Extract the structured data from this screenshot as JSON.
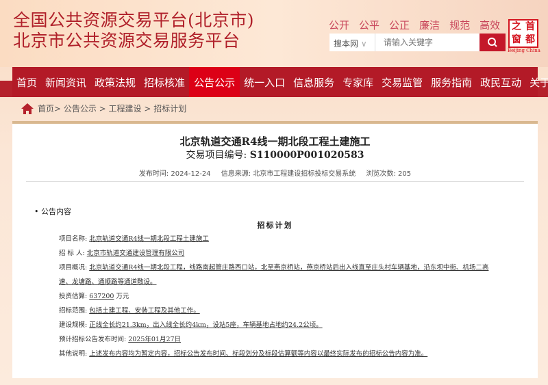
{
  "header": {
    "title1": "全国公共资源交易平台(北京市)",
    "title2": "北京市公共资源交易服务平台",
    "slogans": [
      "公开",
      "公平",
      "公正",
      "廉洁",
      "规范",
      "高效"
    ],
    "search_scope": "搜本网",
    "search_placeholder": "请输入关键字",
    "logo_chars": [
      "之",
      "首",
      "窗",
      "都"
    ],
    "logo_sub": "Beijing China"
  },
  "nav": [
    "首页",
    "新闻资讯",
    "政策法规",
    "招标核准",
    "公告公示",
    "统一入口",
    "信息服务",
    "专家库",
    "交易监管",
    "服务指南",
    "政民互动",
    "关于中心"
  ],
  "breadcrumb": "首页> 公告公示 > 工程建设 > 招标计划",
  "article": {
    "title": "北京轨道交通R4线一期北段工程土建施工",
    "code_label": "交易项目编号:",
    "code": "S110000P001020583",
    "publish": "发布时间: 2024-12-24",
    "source": "信息来源: 北京市工程建设招标投标交易系统",
    "views": "浏览次数: 205",
    "section": "• 公告内容",
    "plan_title": "招标计划",
    "rows": [
      {
        "label": "项目名称:",
        "value": "北京轨道交通R4线一期北段工程土建施工",
        "suffix": ""
      },
      {
        "label": "招 标 人:",
        "value": "北京市轨道交通建设管理有限公司",
        "suffix": ""
      },
      {
        "label": "项目概况:",
        "value": "北京轨道交通R4线一期北段工程，线路南起管庄路西口站，北至燕京桥站，燕京桥站后出入线直至庄头村车辆基地，沿东坝中街、机场二高速、龙塘路、通顺路等通道敷设。",
        "suffix": ""
      },
      {
        "label": "投资估算:",
        "value": "637200",
        "suffix": "万元"
      },
      {
        "label": "招标范围:",
        "value": "包括土建工程、安装工程及其他工作。",
        "suffix": ""
      },
      {
        "label": "建设规模:",
        "value": "正线全长约21.3km，出入线全长约4km，设站5座，车辆基地占地约24.2公顷。",
        "suffix": ""
      },
      {
        "label": "预计招标公告发布时间:",
        "value": "2025年01月27日",
        "suffix": ""
      },
      {
        "label": "其他说明:",
        "value": "上述发布内容均为暂定内容，招标公告发布时间、标段划分及标段估算额等内容以最终实际发布的招标公告内容为准。",
        "suffix": ""
      }
    ]
  }
}
